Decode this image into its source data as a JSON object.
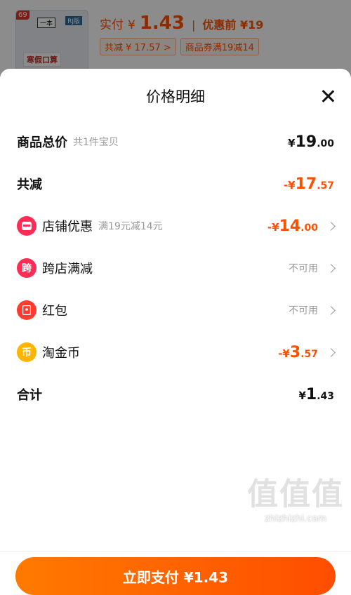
{
  "header": {
    "thumb_tag": "69",
    "thumb_brand": "一本",
    "thumb_rj": "RJ版",
    "thumb_title": "寒假口算",
    "actual_pay_label": "实付",
    "actual_pay_currency": "¥",
    "actual_pay_value": "1.43",
    "before_discount": "优惠前 ¥19",
    "chip_total_reduce": "共减 ¥ 17.57 >",
    "chip_coupon": "商品券满19减14"
  },
  "sheet": {
    "title": "价格明细",
    "rows": [
      {
        "label": "商品总价",
        "sub": "共1件宝贝",
        "cur": "¥",
        "int": "19",
        "dec": ".00"
      },
      {
        "label": "共减",
        "cur": "-¥",
        "int": "17",
        "dec": ".57"
      },
      {
        "label": "店铺优惠",
        "sub": "满19元减14元",
        "cur": "-¥",
        "int": "14",
        "dec": ".00"
      },
      {
        "label": "跨店满减",
        "status": "不可用"
      },
      {
        "label": "红包",
        "status": "不可用"
      },
      {
        "label": "淘金币",
        "cur": "-¥",
        "int": "3",
        "dec": ".57"
      },
      {
        "label": "合计",
        "cur": "¥",
        "int": "1",
        "dec": ".43"
      }
    ],
    "icons": {
      "shop_icon_glyph": "▭",
      "cross_icon_glyph": "跨",
      "redpacket_icon_glyph": "▢",
      "coin_icon_glyph": "币"
    },
    "pay_button": "立即支付 ¥1.43"
  },
  "watermark": {
    "big": "值值值",
    "small": "zhizhizhi.com"
  },
  "colors": {
    "accent": "#ff5000",
    "shop_icon_bg": "#ff2d55",
    "cross_icon_bg": "#ff2d55",
    "redpacket_icon_bg": "#ff3b30",
    "coin_icon_bg": "#ffb400"
  }
}
